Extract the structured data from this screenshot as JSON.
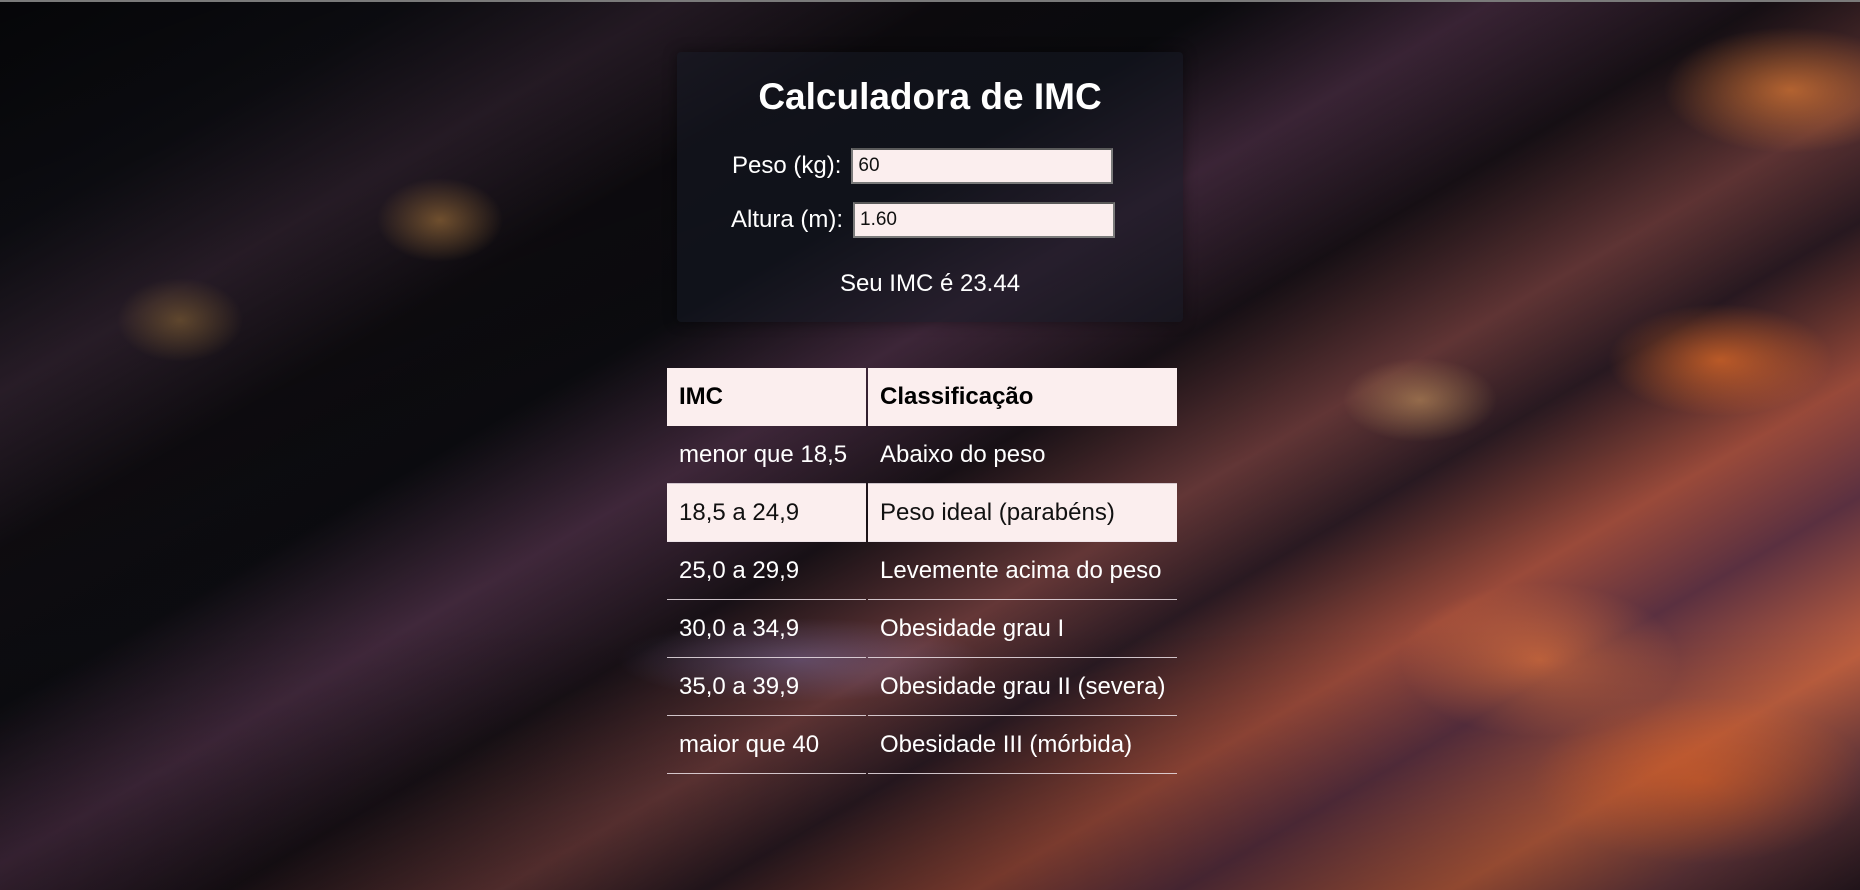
{
  "calculator": {
    "title": "Calculadora de IMC",
    "peso_label": "Peso (kg):",
    "peso_value": "60",
    "altura_label": "Altura (m):",
    "altura_value": "1.60",
    "result_text": "Seu IMC é 23.44"
  },
  "table": {
    "headers": [
      "IMC",
      "Classificação"
    ],
    "rows": [
      {
        "imc": "menor que 18,5",
        "classificacao": "Abaixo do peso",
        "highlighted": false
      },
      {
        "imc": "18,5 a 24,9",
        "classificacao": "Peso ideal (parabéns)",
        "highlighted": true
      },
      {
        "imc": "25,0 a 29,9",
        "classificacao": "Levemente acima do peso",
        "highlighted": false
      },
      {
        "imc": "30,0 a 34,9",
        "classificacao": "Obesidade grau I",
        "highlighted": false
      },
      {
        "imc": "35,0 a 39,9",
        "classificacao": "Obesidade grau II (severa)",
        "highlighted": false
      },
      {
        "imc": "maior que 40",
        "classificacao": "Obesidade III (mórbida)",
        "highlighted": false
      }
    ]
  },
  "colors": {
    "highlight_bg": "#fbeeee",
    "card_bg": "#161a24",
    "text": "#ffffff"
  }
}
